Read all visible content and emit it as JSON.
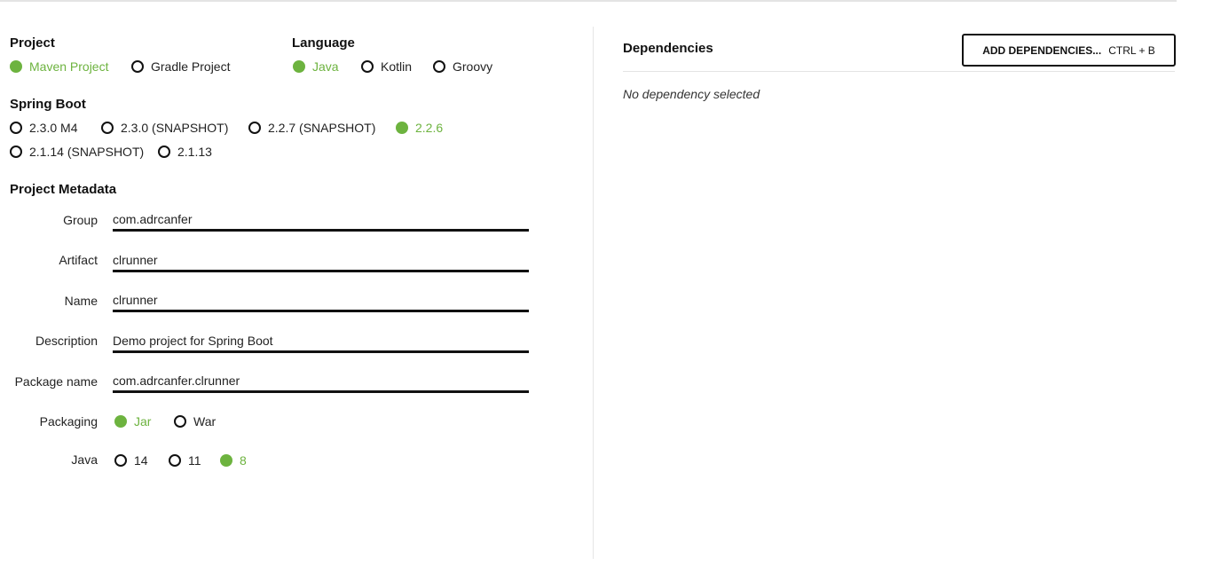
{
  "project": {
    "title": "Project",
    "options": [
      "Maven Project",
      "Gradle Project"
    ],
    "selected": "Maven Project"
  },
  "language": {
    "title": "Language",
    "options": [
      "Java",
      "Kotlin",
      "Groovy"
    ],
    "selected": "Java"
  },
  "spring_boot": {
    "title": "Spring Boot",
    "options": [
      "2.3.0 M4",
      "2.3.0 (SNAPSHOT)",
      "2.2.7 (SNAPSHOT)",
      "2.2.6",
      "2.1.14 (SNAPSHOT)",
      "2.1.13"
    ],
    "selected": "2.2.6"
  },
  "metadata": {
    "title": "Project Metadata",
    "group": {
      "label": "Group",
      "value": "com.adrcanfer"
    },
    "artifact": {
      "label": "Artifact",
      "value": "clrunner"
    },
    "name": {
      "label": "Name",
      "value": "clrunner"
    },
    "description": {
      "label": "Description",
      "value": "Demo project for Spring Boot"
    },
    "package_name": {
      "label": "Package name",
      "value": "com.adrcanfer.clrunner"
    },
    "packaging": {
      "label": "Packaging",
      "options": [
        "Jar",
        "War"
      ],
      "selected": "Jar"
    },
    "java": {
      "label": "Java",
      "options": [
        "14",
        "11",
        "8"
      ],
      "selected": "8"
    }
  },
  "dependencies": {
    "title": "Dependencies",
    "button_label": "ADD DEPENDENCIES...",
    "button_shortcut": "CTRL + B",
    "empty_text": "No dependency selected"
  },
  "colors": {
    "accent": "#6db33f",
    "text": "#222222",
    "border": "#111111"
  }
}
